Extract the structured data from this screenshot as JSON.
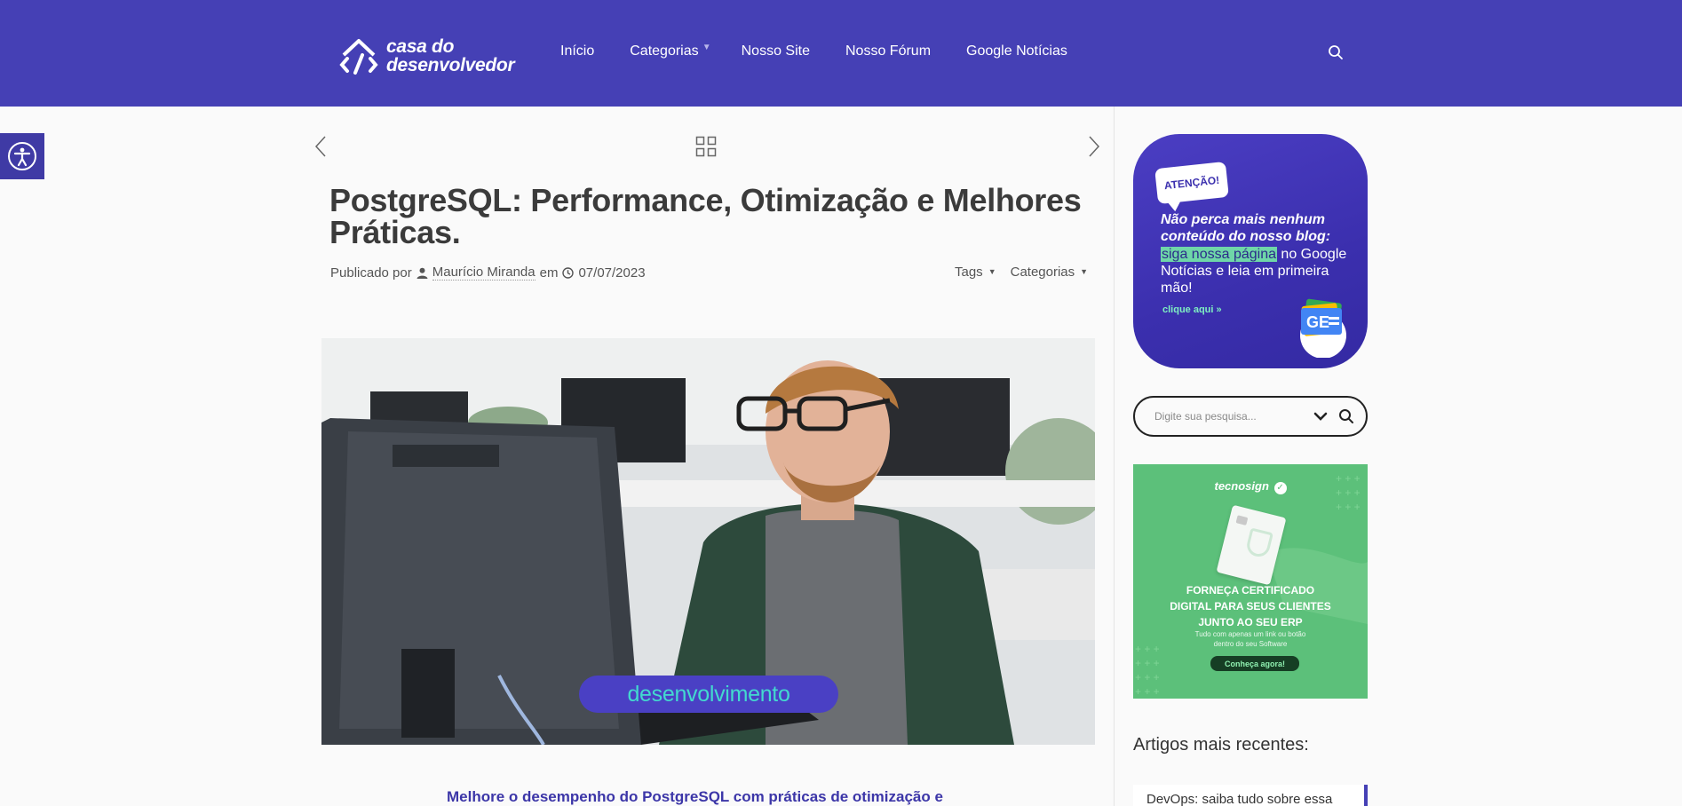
{
  "header": {
    "logo_line1": "casa do",
    "logo_line2": "desenvolvedor",
    "nav": [
      {
        "label": "Início"
      },
      {
        "label": "Categorias",
        "has_dropdown": true
      },
      {
        "label": "Nosso Site"
      },
      {
        "label": "Nosso Fórum"
      },
      {
        "label": "Google Notícias"
      }
    ],
    "search_icon": "search-icon",
    "brand_color": "#4540b5"
  },
  "accessibility": {
    "icon": "accessibility-icon"
  },
  "post_nav": {
    "prev_icon": "chevron-left-icon",
    "grid_icon": "grid-icon",
    "next_icon": "chevron-right-icon"
  },
  "post": {
    "title": "PostgreSQL: Performance, Otimização e Melhores Práticas.",
    "published_by": "Publicado por",
    "author": "Maurício Miranda",
    "in_word": "em",
    "date": "07/07/2023",
    "tags_label": "Tags",
    "categories_label": "Categorias",
    "image_badge": "desenvolvimento",
    "excerpt": "Melhore o desempenho do PostgreSQL com práticas de otimização e"
  },
  "sidebar": {
    "promo": {
      "badge": "ATENÇÃO!",
      "line1": "Não perca mais nenhum conteúdo do nosso blog:",
      "highlight": "siga nossa página",
      "line2_rest": " no Google Notícias e leia em primeira mão!",
      "cta": "clique aqui »"
    },
    "search": {
      "placeholder": "Digite sua pesquisa..."
    },
    "ad": {
      "brand": "tecnosign",
      "headline_1": "FORNEÇA CERTIFICADO",
      "headline_2": "DIGITAL PARA SEUS CLIENTES",
      "headline_3": "JUNTO AO SEU ERP",
      "sub_1": "Tudo com apenas um link ou botão",
      "sub_2": "dentro do seu Software",
      "button": "Conheça agora!"
    },
    "recent_title": "Artigos mais recentes:",
    "recent_items": [
      {
        "label": "DevOps: saiba tudo sobre essa"
      }
    ]
  }
}
